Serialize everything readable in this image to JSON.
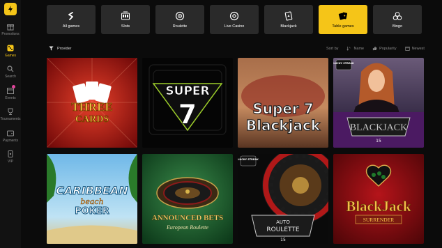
{
  "sidebar": {
    "items": [
      {
        "label": "Promotions",
        "icon": "gift-icon"
      },
      {
        "label": "Games",
        "icon": "dice-icon",
        "active": true
      },
      {
        "label": "Search",
        "icon": "search-icon"
      },
      {
        "label": "Events",
        "icon": "calendar-icon",
        "has_badge": true
      },
      {
        "label": "Tournaments",
        "icon": "trophy-icon"
      },
      {
        "label": "Payments",
        "icon": "wallet-icon"
      },
      {
        "label": "VIP",
        "icon": "vip-card-icon"
      }
    ]
  },
  "categories": [
    {
      "label": "All games",
      "icon": "lightning-s-icon"
    },
    {
      "label": "Slots",
      "icon": "slot-machine-icon"
    },
    {
      "label": "Roulette",
      "icon": "roulette-icon"
    },
    {
      "label": "Live Casino",
      "icon": "live-casino-icon"
    },
    {
      "label": "Blackjack",
      "icon": "blackjack-card-icon"
    },
    {
      "label": "Table games",
      "icon": "table-cards-icon",
      "active": true
    },
    {
      "label": "Bingo",
      "icon": "bingo-balls-icon"
    }
  ],
  "filter": {
    "provider_label": "Provider",
    "sort_by_label": "Sort by",
    "sort_options": [
      {
        "label": "Name",
        "icon": "sort-alpha-icon"
      },
      {
        "label": "Popularity",
        "icon": "thumbs-up-icon"
      },
      {
        "label": "Newest",
        "icon": "calendar-icon"
      }
    ]
  },
  "games": [
    {
      "title": "THREE CARDS",
      "line1": "THREE",
      "line2": "CARDS"
    },
    {
      "title": "SUPER 7",
      "line1": "SUPER",
      "line2": "7"
    },
    {
      "title": "Super 7 Blackjack",
      "line1": "Super 7",
      "line2": "Blackjack"
    },
    {
      "title": "BLACKJACK",
      "badge": "LUCKY STREAK",
      "line1": "BLACKJACK",
      "line2": "15"
    },
    {
      "title": "CARIBBEAN beach POKER",
      "line1": "CARIBBEAN",
      "line2": "beach",
      "line3": "POKER"
    },
    {
      "title": "ANNOUNCED BETS European Roulette",
      "line1": "ANNOUNCED BETS",
      "line2": "European Roulette"
    },
    {
      "title": "AUTO ROULETTE",
      "badge": "LUCKY STREAK",
      "line1": "AUTO",
      "line2": "ROULETTE",
      "line3": "15"
    },
    {
      "title": "BlackJack SURRENDER",
      "line1": "BlackJack",
      "line2": "SURRENDER"
    }
  ]
}
